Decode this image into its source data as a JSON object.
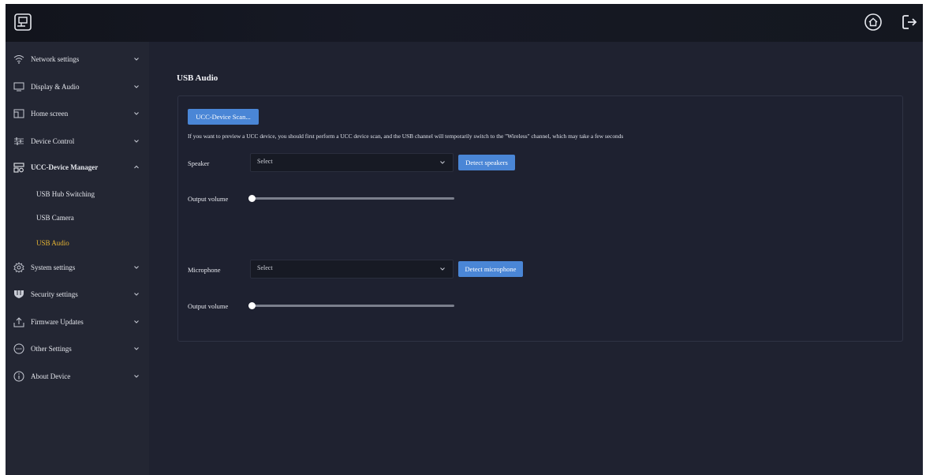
{
  "sidebar": {
    "items": [
      {
        "label": "Network settings",
        "icon": "wifi-icon"
      },
      {
        "label": "Display & Audio",
        "icon": "monitor-icon"
      },
      {
        "label": "Home screen",
        "icon": "home-screen-icon"
      },
      {
        "label": "Device Control",
        "icon": "sliders-icon"
      },
      {
        "label": "UCC-Device Manager",
        "icon": "device-manager-icon"
      },
      {
        "label": "System settings",
        "icon": "gear-icon"
      },
      {
        "label": "Security settings",
        "icon": "shield-icon"
      },
      {
        "label": "Firmware Updates",
        "icon": "upload-icon"
      },
      {
        "label": "Other Settings",
        "icon": "more-icon"
      },
      {
        "label": "About Device",
        "icon": "info-icon"
      }
    ],
    "sub_items": [
      {
        "label": "USB Hub Switching"
      },
      {
        "label": "USB Camera"
      },
      {
        "label": "USB Audio",
        "active": true
      }
    ]
  },
  "header": {
    "icons": [
      "logo-icon",
      "home-icon",
      "logout-icon"
    ]
  },
  "main": {
    "title": "USB Audio",
    "scan_button": "UCC-Device Scan...",
    "info_text": "If you want to preview a UCC device, you should first perform a UCC device scan, and the USB channel will temporarily switch to the \"Wireless\" channel, which may take a few seconds",
    "speaker": {
      "label": "Speaker",
      "select_value": "Select",
      "detect_button": "Detect speakers",
      "volume_label": "Output volume",
      "volume_value": 0
    },
    "microphone": {
      "label": "Microphone",
      "select_value": "Select",
      "detect_button": "Detect microphone",
      "volume_label": "Output volume",
      "volume_value": 0
    }
  },
  "colors": {
    "accent": "#4a86d6",
    "active_text": "#e7b533",
    "background": "#1f2230",
    "sidebar": "#232633"
  }
}
